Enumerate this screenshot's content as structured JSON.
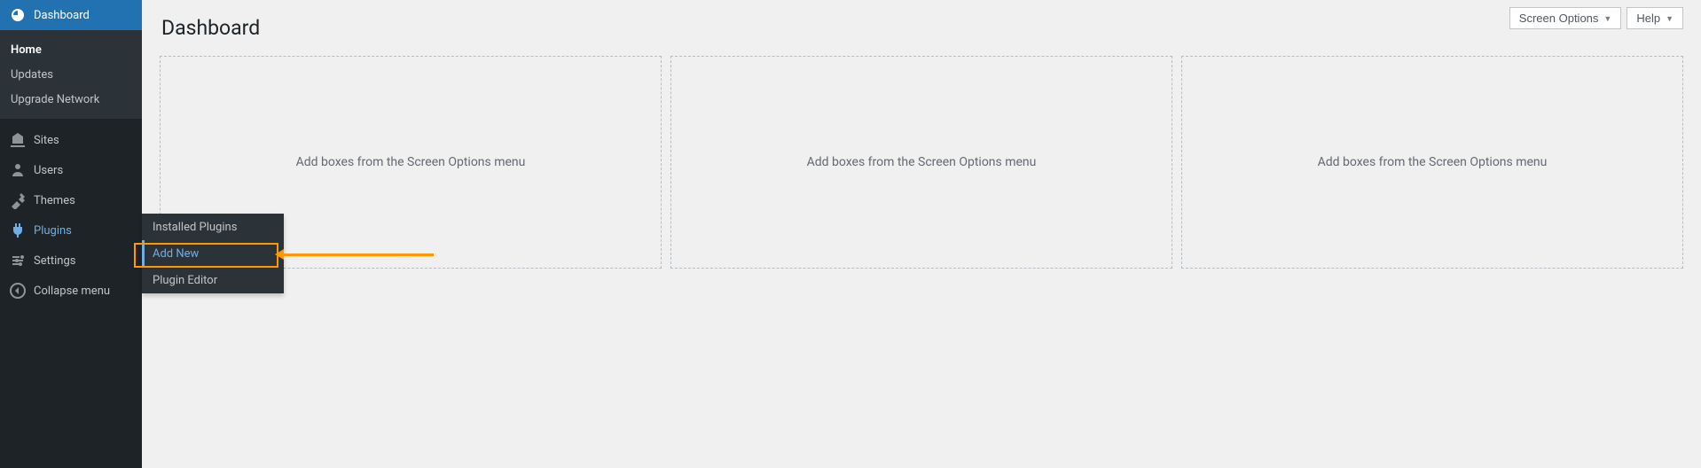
{
  "sidebar": {
    "items": [
      {
        "label": "Dashboard",
        "icon": "dashboard"
      },
      {
        "label": "Sites",
        "icon": "sites"
      },
      {
        "label": "Users",
        "icon": "users"
      },
      {
        "label": "Themes",
        "icon": "themes"
      },
      {
        "label": "Plugins",
        "icon": "plugins"
      },
      {
        "label": "Settings",
        "icon": "settings"
      },
      {
        "label": "Collapse menu",
        "icon": "collapse"
      }
    ],
    "dashboard_subitems": [
      {
        "label": "Home"
      },
      {
        "label": "Updates"
      },
      {
        "label": "Upgrade Network"
      }
    ],
    "plugins_flyout": [
      {
        "label": "Installed Plugins"
      },
      {
        "label": "Add New"
      },
      {
        "label": "Plugin Editor"
      }
    ]
  },
  "topbar": {
    "screen_options": "Screen Options",
    "help": "Help"
  },
  "page": {
    "title": "Dashboard",
    "box_placeholder": "Add boxes from the Screen Options menu"
  }
}
